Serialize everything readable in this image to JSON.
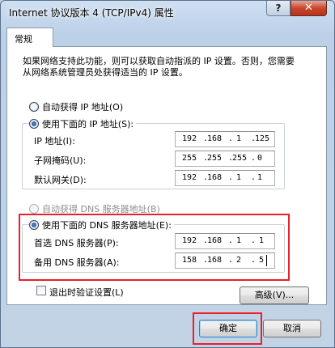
{
  "window": {
    "title": "Internet 协议版本 4 (TCP/IPv4) 属性",
    "help_glyph": "?",
    "close_glyph": "✕"
  },
  "tab": {
    "label": "常规"
  },
  "description": "如果网络支持此功能，则可以获取自动指派的 IP 设置。否则，您需要从网络系统管理员处获得适当的 IP 设置。",
  "ip_section": {
    "auto_label": "自动获得 IP 地址(O)",
    "manual_label": "使用下面的 IP 地址(S):",
    "auto_selected": false,
    "fields": [
      {
        "label": "IP 地址(I):",
        "octets": [
          "192",
          "168",
          "1",
          "125"
        ]
      },
      {
        "label": "子网掩码(U):",
        "octets": [
          "255",
          "255",
          "255",
          "0"
        ]
      },
      {
        "label": "默认网关(D):",
        "octets": [
          "192",
          "168",
          "1",
          "1"
        ]
      }
    ]
  },
  "dns_section": {
    "auto_label": "自动获得 DNS 服务器地址(B)",
    "manual_label": "使用下面的 DNS 服务器地址(E):",
    "auto_disabled": true,
    "fields": [
      {
        "label": "首选 DNS 服务器(P):",
        "octets": [
          "192",
          "168",
          "1",
          "1"
        ]
      },
      {
        "label": "备用 DNS 服务器(A):",
        "octets": [
          "158",
          "168",
          "2",
          "5"
        ]
      }
    ]
  },
  "validate_on_exit": {
    "label": "退出时验证设置(L)",
    "checked": false
  },
  "buttons": {
    "advanced": "高级(V)...",
    "ok": "确定",
    "cancel": "取消"
  },
  "colors": {
    "highlight": "#e8202a",
    "close_button": "#c9462c"
  }
}
